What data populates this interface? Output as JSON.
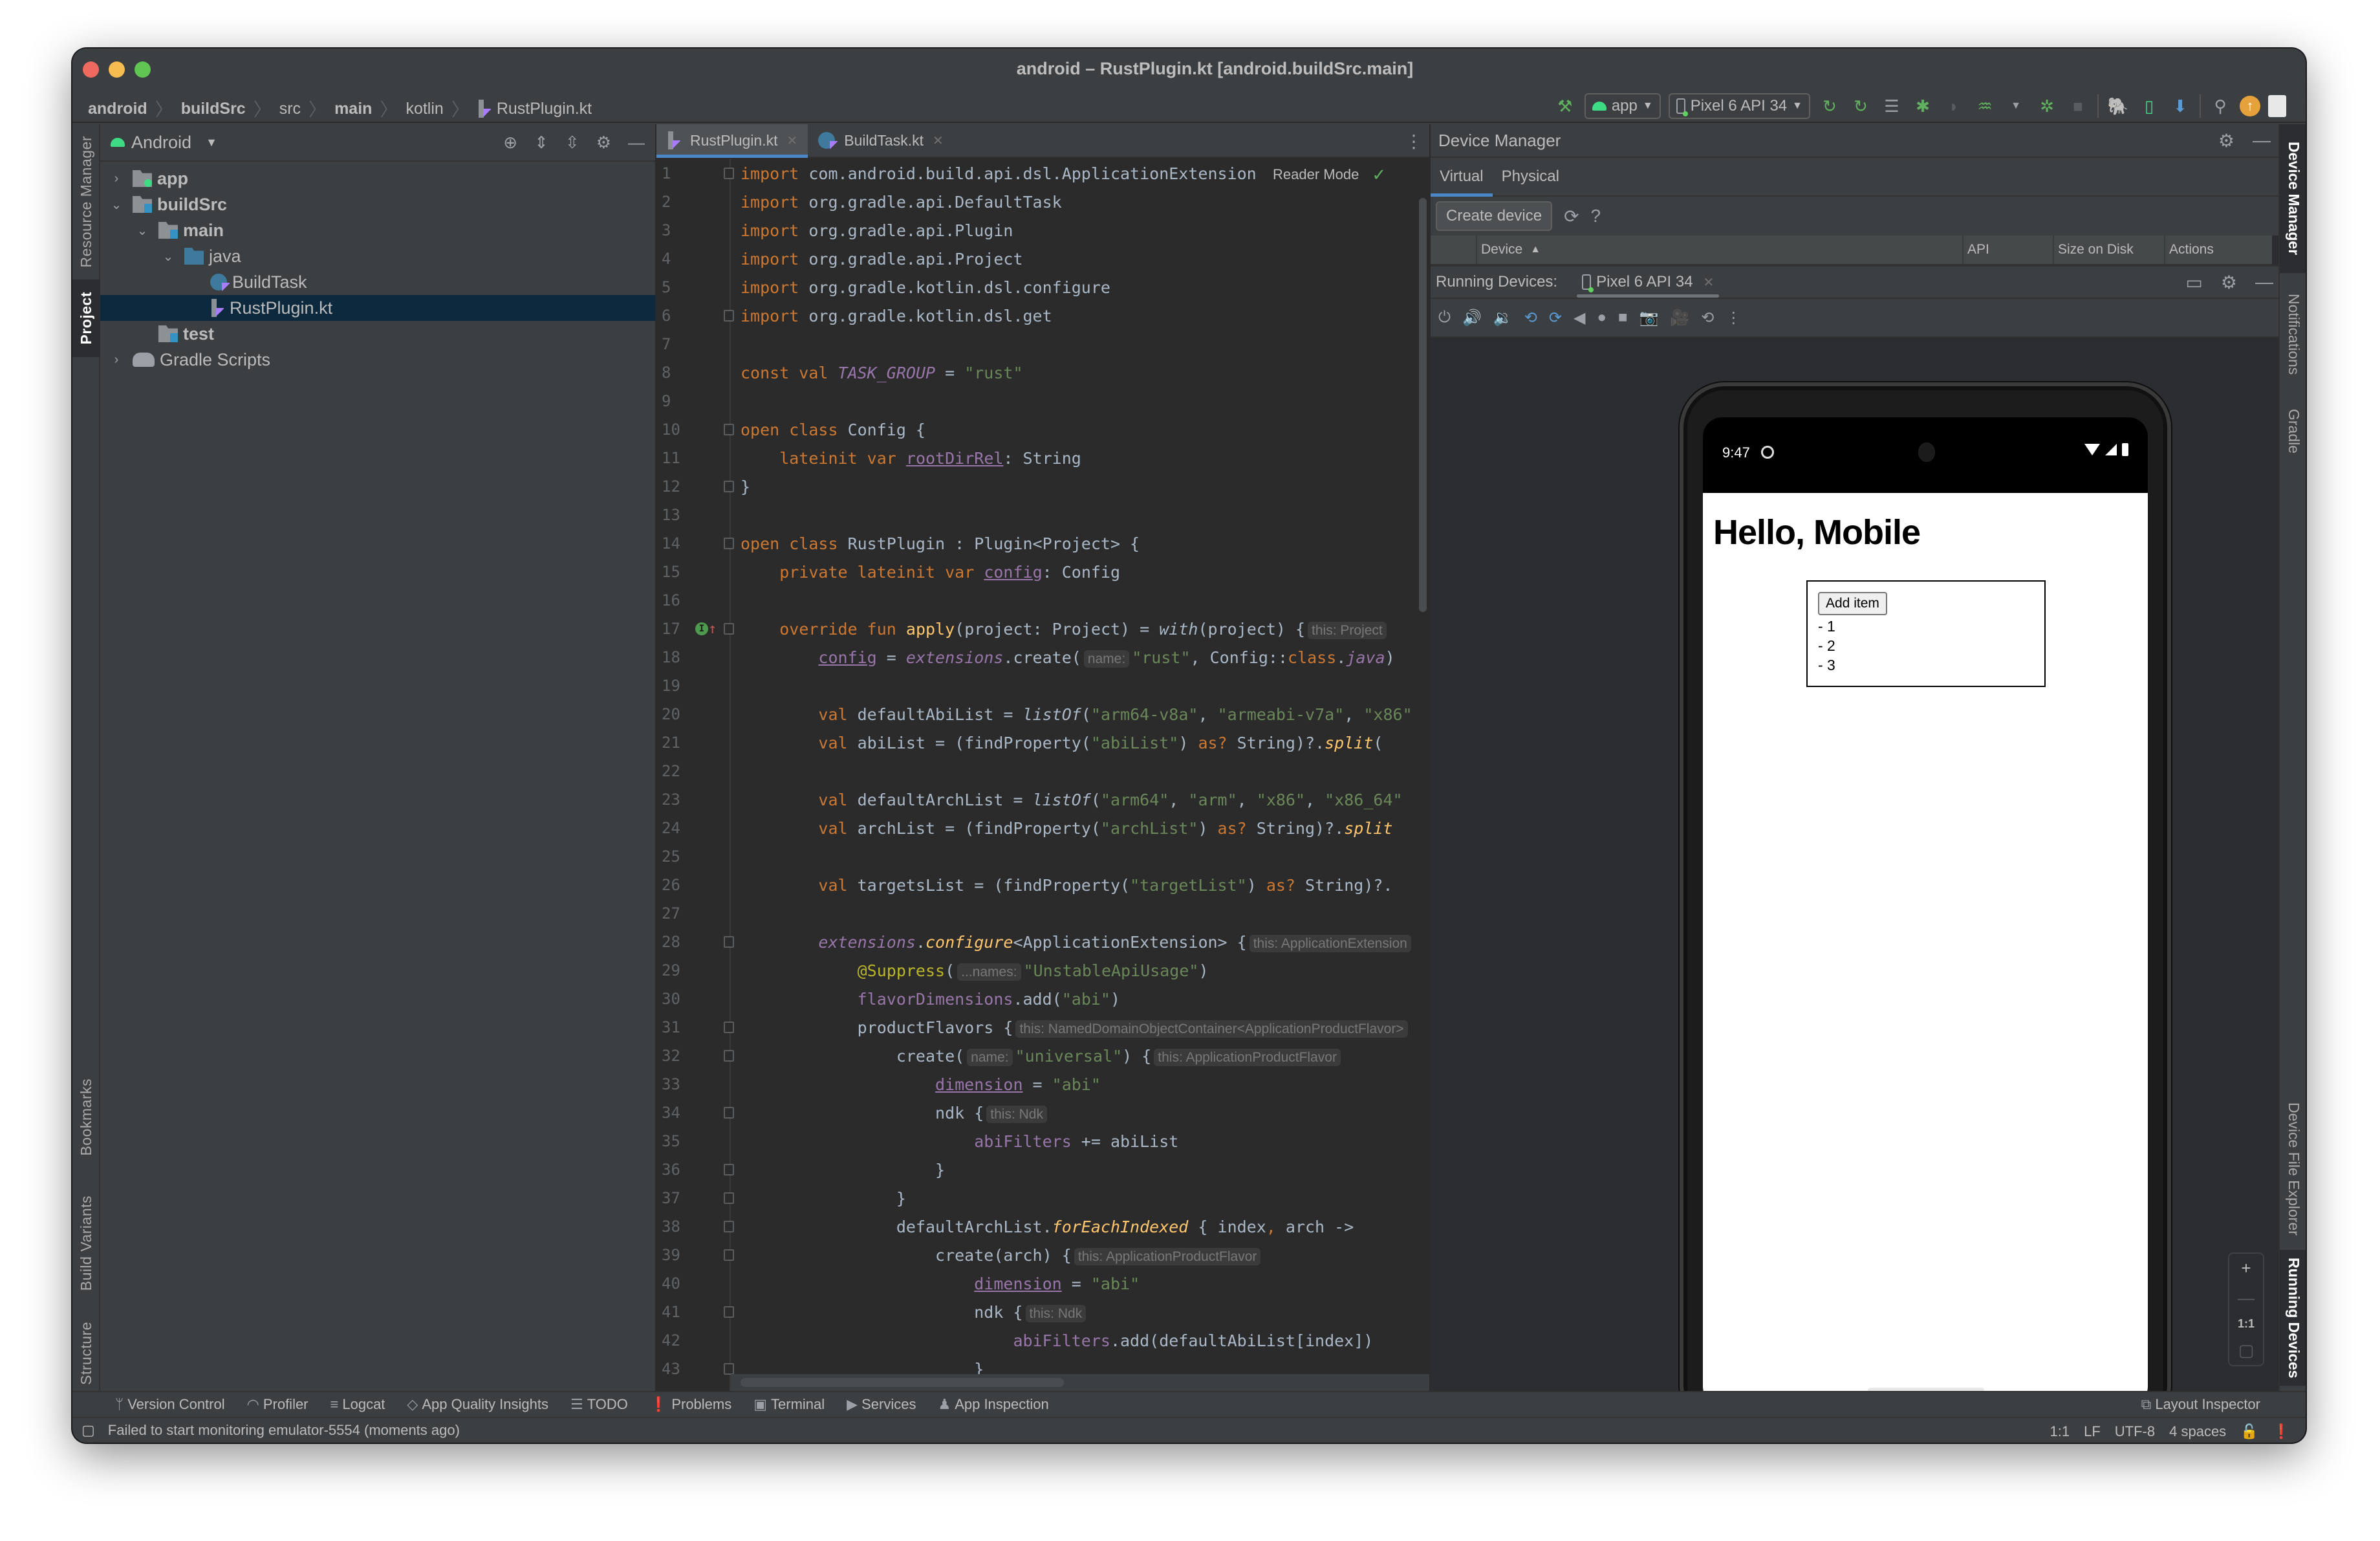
{
  "window": {
    "title": "android – RustPlugin.kt [android.buildSrc.main]"
  },
  "breadcrumb": [
    {
      "label": "android",
      "bold": true
    },
    {
      "label": "buildSrc",
      "bold": true
    },
    {
      "label": "src",
      "bold": false
    },
    {
      "label": "main",
      "bold": true
    },
    {
      "label": "kotlin",
      "bold": false
    },
    {
      "label": "RustPlugin.kt",
      "bold": false
    }
  ],
  "toolbar": {
    "run_config": "app",
    "device": "Pixel 6 API 34",
    "icons": [
      "build-hammer-icon",
      "rerun-icon",
      "apply-changes-icon",
      "apply-code-changes-icon",
      "debug-icon",
      "profile-icon",
      "attach-debugger-icon",
      "coverage-icon",
      "stop-icon",
      "gradle-sync-icon",
      "device-manager-icon",
      "sdk-manager-icon",
      "search-icon",
      "update-icon",
      "account-icon"
    ]
  },
  "left_stripe": {
    "top": [
      "Resource Manager",
      "Project"
    ],
    "bottom": [
      "Bookmarks",
      "Build Variants",
      "Structure"
    ]
  },
  "project_panel": {
    "view": "Android",
    "tree": [
      {
        "label": "app",
        "depth": 0,
        "type": "module-app",
        "expanded": false,
        "bold": true
      },
      {
        "label": "buildSrc",
        "depth": 0,
        "type": "module-src",
        "expanded": true,
        "bold": true
      },
      {
        "label": "main",
        "depth": 1,
        "type": "module-src",
        "expanded": true,
        "bold": true
      },
      {
        "label": "java",
        "depth": 2,
        "type": "folder-java",
        "expanded": true,
        "bold": false
      },
      {
        "label": "BuildTask",
        "depth": 3,
        "type": "kotlin-class",
        "expanded": null,
        "bold": false
      },
      {
        "label": "RustPlugin.kt",
        "depth": 3,
        "type": "kotlin-file",
        "expanded": null,
        "bold": false,
        "selected": true
      },
      {
        "label": "test",
        "depth": 1,
        "type": "module-src",
        "expanded": null,
        "bold": true
      },
      {
        "label": "Gradle Scripts",
        "depth": 0,
        "type": "gradle",
        "expanded": false,
        "bold": false
      }
    ]
  },
  "editor": {
    "tabs": [
      {
        "label": "RustPlugin.kt",
        "active": true
      },
      {
        "label": "BuildTask.kt",
        "active": false
      }
    ],
    "reader_mode": "Reader Mode",
    "lines": [
      {
        "n": 1,
        "fold": "start",
        "html": "<span class='kw'>import</span> com.android.build.api.dsl.ApplicationExtension"
      },
      {
        "n": 2,
        "html": "<span class='kw'>import</span> org.gradle.api.DefaultTask"
      },
      {
        "n": 3,
        "html": "<span class='kw'>import</span> org.gradle.api.Plugin"
      },
      {
        "n": 4,
        "html": "<span class='kw'>import</span> org.gradle.api.Project"
      },
      {
        "n": 5,
        "html": "<span class='kw'>import</span> org.gradle.kotlin.dsl.configure"
      },
      {
        "n": 6,
        "fold": "end",
        "html": "<span class='kw'>import</span> org.gradle.kotlin.dsl.get"
      },
      {
        "n": 7,
        "html": ""
      },
      {
        "n": 8,
        "html": "<span class='kw'>const val</span> <span class='prop ital'>TASK_GROUP</span> = <span class='str'>\"rust\"</span>"
      },
      {
        "n": 9,
        "html": ""
      },
      {
        "n": 10,
        "fold": "start",
        "html": "<span class='kw'>open class</span> Config {"
      },
      {
        "n": 11,
        "html": "    <span class='kw'>lateinit var</span> <span class='prop ul'>rootDirRel</span>: String"
      },
      {
        "n": 12,
        "fold": "end",
        "html": "}"
      },
      {
        "n": 13,
        "html": ""
      },
      {
        "n": 14,
        "fold": "start",
        "html": "<span class='kw'>open class</span> RustPlugin : Plugin&lt;Project&gt; {"
      },
      {
        "n": 15,
        "html": "    <span class='kw'>private lateinit var</span> <span class='prop ul'>config</span>: Config"
      },
      {
        "n": 16,
        "html": ""
      },
      {
        "n": 17,
        "fold": "start",
        "marker": "implements",
        "html": "    <span class='kw'>override fun</span> <span class='fn'>apply</span>(project: Project) = <span class='ital'>with</span>(project) {<span class='hint'>this: Project</span>"
      },
      {
        "n": 18,
        "html": "        <span class='prop ul'>config</span> = <span class='prop ital'>extensions</span>.create(<span class='hint'>name:</span><span class='str'>\"rust\"</span>, Config::<span class='kw'>class</span>.<span class='prop ital'>java</span>)"
      },
      {
        "n": 19,
        "html": ""
      },
      {
        "n": 20,
        "html": "        <span class='kw'>val</span> defaultAbiList = <span class='ital'>listOf</span>(<span class='str'>\"arm64-v8a\"</span>, <span class='str'>\"armeabi-v7a\"</span>, <span class='str'>\"x86\"</span>"
      },
      {
        "n": 21,
        "html": "        <span class='kw'>val</span> abiList = (findProperty(<span class='str'>\"abiList\"</span>) <span class='kw'>as?</span> String)?.<span class='fn ital'>split</span>("
      },
      {
        "n": 22,
        "html": ""
      },
      {
        "n": 23,
        "html": "        <span class='kw'>val</span> defaultArchList = <span class='ital'>listOf</span>(<span class='str'>\"arm64\"</span>, <span class='str'>\"arm\"</span>, <span class='str'>\"x86\"</span>, <span class='str'>\"x86_64\"</span>"
      },
      {
        "n": 24,
        "html": "        <span class='kw'>val</span> archList = (findProperty(<span class='str'>\"archList\"</span>) <span class='kw'>as?</span> String)?.<span class='fn ital'>split</span>"
      },
      {
        "n": 25,
        "html": ""
      },
      {
        "n": 26,
        "html": "        <span class='kw'>val</span> targetsList = (findProperty(<span class='str'>\"targetList\"</span>) <span class='kw'>as?</span> String)?."
      },
      {
        "n": 27,
        "html": ""
      },
      {
        "n": 28,
        "fold": "start",
        "html": "        <span class='prop ital'>extensions</span>.<span class='fn ital'>configure</span>&lt;ApplicationExtension&gt; {<span class='hint'>this: ApplicationExtension</span>"
      },
      {
        "n": 29,
        "html": "            <span class='ann'>@Suppress</span>(<span class='hint'>...names:</span><span class='str'>\"UnstableApiUsage\"</span>)"
      },
      {
        "n": 30,
        "html": "            <span class='prop'>flavorDimensions</span>.add(<span class='str'>\"abi\"</span>)"
      },
      {
        "n": 31,
        "fold": "start",
        "html": "            productFlavors {<span class='hint'>this: NamedDomainObjectContainer&lt;ApplicationProductFlavor&gt;</span>"
      },
      {
        "n": 32,
        "fold": "start",
        "html": "                create(<span class='hint'>name:</span><span class='str'>\"universal\"</span>) {<span class='hint'>this: ApplicationProductFlavor</span>"
      },
      {
        "n": 33,
        "html": "                    <span class='prop ul'>dimension</span> = <span class='str'>\"abi\"</span>"
      },
      {
        "n": 34,
        "fold": "start",
        "html": "                    ndk {<span class='hint'>this: Ndk</span>"
      },
      {
        "n": 35,
        "html": "                        <span class='prop'>abiFilters</span> += abiList"
      },
      {
        "n": 36,
        "fold": "end",
        "html": "                    }"
      },
      {
        "n": 37,
        "fold": "end",
        "html": "                }"
      },
      {
        "n": 38,
        "fold": "start",
        "html": "                defaultArchList.<span class='fn ital'>forEachIndexed</span> { index<span class='kw'>,</span> arch -&gt;"
      },
      {
        "n": 39,
        "fold": "start",
        "html": "                    create(arch) {<span class='hint'>this: ApplicationProductFlavor</span>"
      },
      {
        "n": 40,
        "html": "                        <span class='prop ul'>dimension</span> = <span class='str'>\"abi\"</span>"
      },
      {
        "n": 41,
        "fold": "start",
        "html": "                        ndk {<span class='hint'>this: Ndk</span>"
      },
      {
        "n": 42,
        "html": "                            <span class='prop'>abiFilters</span>.add(defaultAbiList[index])"
      },
      {
        "n": 43,
        "fold": "end",
        "html": "                        }"
      }
    ]
  },
  "device_manager": {
    "title": "Device Manager",
    "tabs": [
      {
        "label": "Virtual",
        "active": true
      },
      {
        "label": "Physical",
        "active": false
      }
    ],
    "create_button": "Create device",
    "help": "?",
    "columns": [
      "Device",
      "API",
      "Size on Disk",
      "Actions"
    ],
    "sort_indicator": "▲"
  },
  "running_devices": {
    "label": "Running Devices:",
    "tab": "Pixel 6 API 34",
    "emulator_controls": [
      "power-icon",
      "volume-up-icon",
      "volume-down-icon",
      "rotate-left-icon",
      "rotate-right-icon",
      "back-icon",
      "home-icon",
      "overview-icon",
      "screenshot-icon",
      "screen-record-icon",
      "snapshot-icon",
      "more-icon"
    ],
    "zoom": {
      "in": "+",
      "out": "—",
      "actual": "1:1"
    }
  },
  "phone": {
    "time": "9:47",
    "heading": "Hello, Mobile",
    "add_button": "Add item",
    "items": [
      "- 1",
      "- 2",
      "- 3"
    ]
  },
  "right_stripe": {
    "top": [
      "Device Manager",
      "Notifications",
      "Gradle"
    ],
    "bottom": [
      "Device File Explorer",
      "Running Devices"
    ]
  },
  "bottom_tools": [
    {
      "label": "Version Control",
      "icon": "branch-icon"
    },
    {
      "label": "Profiler",
      "icon": "profiler-icon"
    },
    {
      "label": "Logcat",
      "icon": "logcat-icon"
    },
    {
      "label": "App Quality Insights",
      "icon": "diamond-icon"
    },
    {
      "label": "TODO",
      "icon": "list-icon"
    },
    {
      "label": "Problems",
      "icon": "warning-icon"
    },
    {
      "label": "Terminal",
      "icon": "terminal-icon"
    },
    {
      "label": "Services",
      "icon": "services-icon"
    },
    {
      "label": "App Inspection",
      "icon": "inspection-icon"
    }
  ],
  "bottom_tools_right": {
    "label": "Layout Inspector"
  },
  "status_bar": {
    "message": "Failed to start monitoring emulator-5554 (moments ago)",
    "position": "1:1",
    "line_sep": "LF",
    "encoding": "UTF-8",
    "indent": "4 spaces"
  }
}
